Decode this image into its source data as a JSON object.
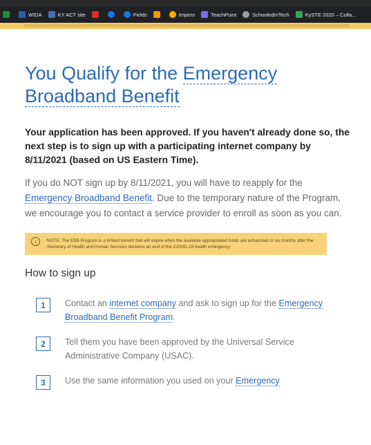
{
  "bookmarks": [
    {
      "label": "",
      "icon": "green-square-icon",
      "color": "#1e8e3e"
    },
    {
      "label": "WIDA",
      "icon": "wida-icon",
      "color": "#2a5db0"
    },
    {
      "label": "KY ACT site",
      "icon": "act-icon",
      "color": "#4a6fb5"
    },
    {
      "label": "",
      "icon": "red-a-icon",
      "color": "#d93025"
    },
    {
      "label": "",
      "icon": "blue-circle-icon",
      "color": "#1a73e8"
    },
    {
      "label": "Fields",
      "icon": "fields-icon",
      "color": "#1a73e8"
    },
    {
      "label": "",
      "icon": "w-icon",
      "color": "#f29900"
    },
    {
      "label": "Impero",
      "icon": "impero-icon",
      "color": "#f9ab00"
    },
    {
      "label": "TeachPoint",
      "icon": "teachpoint-icon",
      "color": "#7b68ee"
    },
    {
      "label": "SchooledInTech",
      "icon": "schooledintech-icon",
      "color": "#9aa0a6"
    },
    {
      "label": "KySTE 2020 – Colla...",
      "icon": "kyste-icon",
      "color": "#34a853"
    }
  ],
  "page": {
    "title_line1": "You Qualify for the ",
    "title_link1": "Emergency",
    "title_link2": "Broadband Benefit",
    "approved_text": "Your application has been approved. If you haven't already done so, the next step is to sign up with a participating internet company by 8/11/2021 (based on US Eastern Time).",
    "para_part1": "If you do NOT sign up by 8/11/2021, you will have to reapply for the ",
    "para_link": "Emergency Broadband Benefit",
    "para_part2": ". Due to the temporary nature of the Program, we encourage you to contact a service provider to enroll as soon as you can.",
    "note_text": "NOTE: The EBB Program is a limited benefit that will expire when the available appropriated funds are exhausted or six months after the Secretary of Health and Human Services declares an end of the COVID-19 health emergency.",
    "how_to_heading": "How to sign up",
    "steps": [
      {
        "num": "1",
        "pre": "Contact an ",
        "link": "internet company",
        "mid": " and ask to sign up for the ",
        "link2": "Emergency Broadband Benefit Program",
        "post": "."
      },
      {
        "num": "2",
        "text": "Tell them you have been approved by the Universal Service Administrative Company (USAC)."
      },
      {
        "num": "3",
        "pre": "Use the same information you used on your ",
        "link": "Emergency"
      }
    ]
  },
  "colors": {
    "link": "#2a6ab3",
    "note_bg": "#f7d27a",
    "bookmarks_bg": "#202124"
  }
}
